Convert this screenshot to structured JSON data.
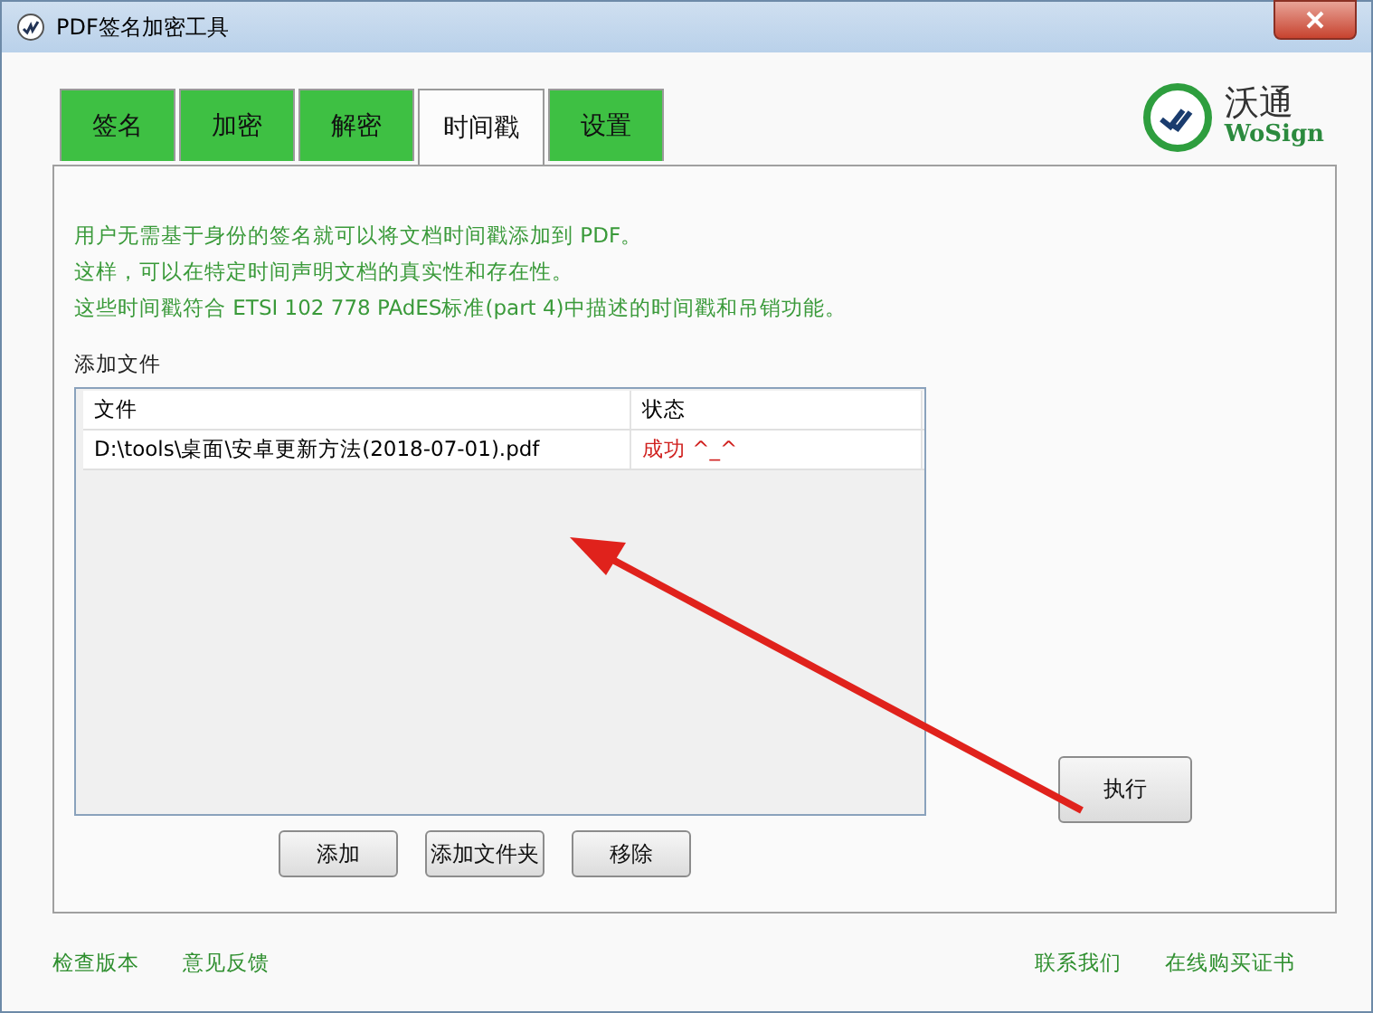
{
  "window": {
    "title": "PDF签名加密工具"
  },
  "tabs": [
    {
      "label": "签名",
      "selected": false
    },
    {
      "label": "加密",
      "selected": false
    },
    {
      "label": "解密",
      "selected": false
    },
    {
      "label": "时间戳",
      "selected": true
    },
    {
      "label": "设置",
      "selected": false
    }
  ],
  "logo": {
    "name": "沃通",
    "brand": "WoSign"
  },
  "description": [
    "用户无需基于身份的签名就可以将文档时间戳添加到 PDF。",
    "这样，可以在特定时间声明文档的真实性和存在性。",
    "这些时间戳符合 ETSI 102 778 PAdES标准(part 4)中描述的时间戳和吊销功能。"
  ],
  "file_list": {
    "label": "添加文件",
    "columns": [
      "文件",
      "状态"
    ],
    "rows": [
      {
        "file": "D:\\tools\\桌面\\安卓更新方法(2018-07-01).pdf",
        "status": "成功 ^_^",
        "kind": "success"
      }
    ]
  },
  "buttons": [
    "添加",
    "添加文件夹",
    "移除"
  ],
  "execute_button": "执行",
  "footer_left": [
    "检查版本",
    "意见反馈"
  ],
  "footer_right": [
    "联系我们",
    "在线购买证书"
  ]
}
